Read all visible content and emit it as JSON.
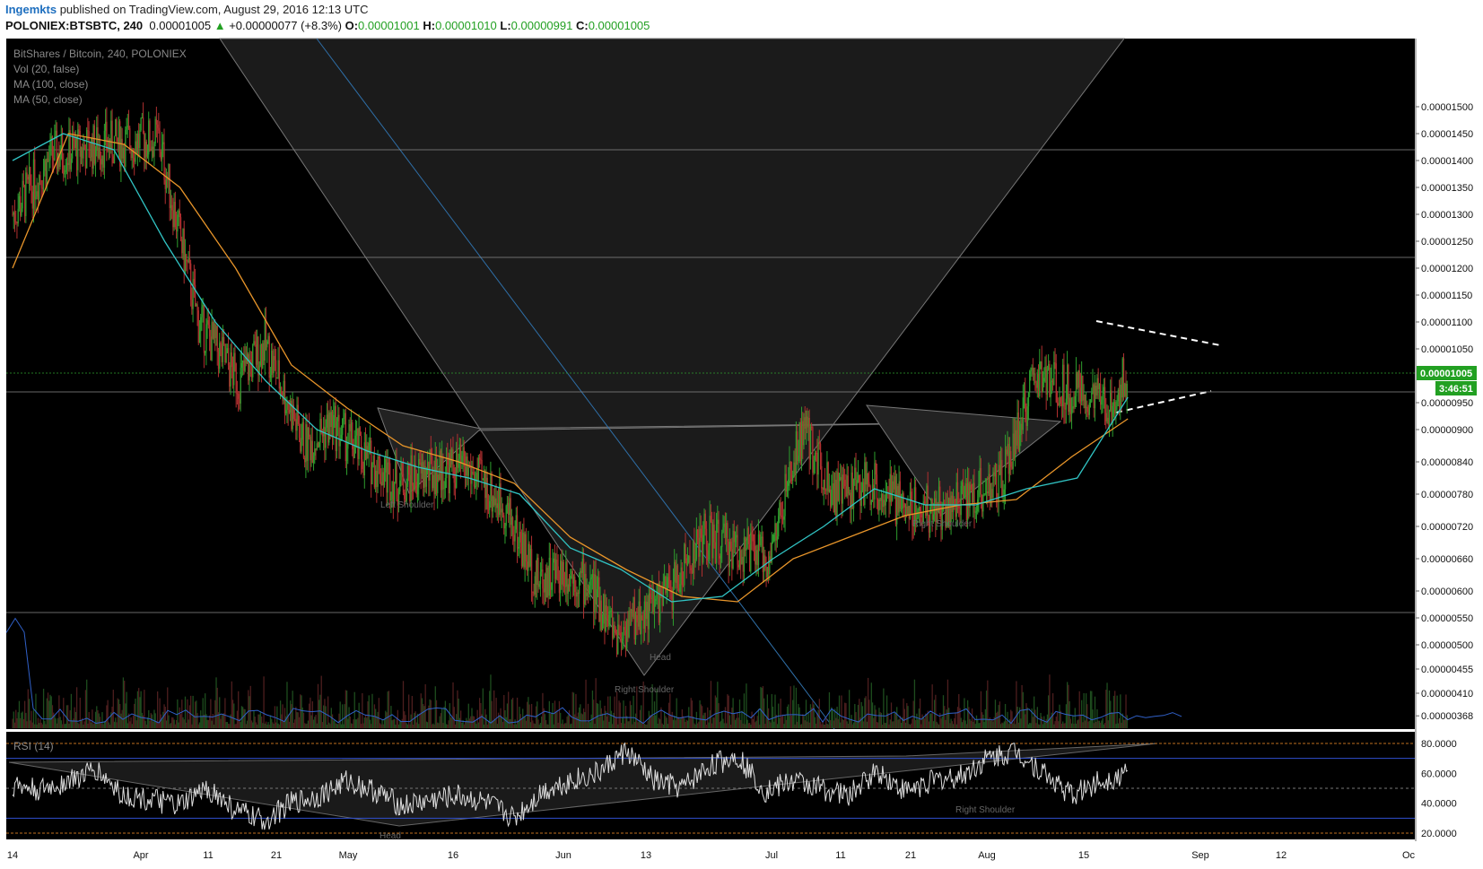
{
  "header": {
    "author": "Ingemkts",
    "published": "published on TradingView.com, August 29, 2016 12:13 UTC",
    "symbol": "POLONIEX:BTSBTC, 240",
    "price": "0.00001005",
    "change_arrow": "▲",
    "change": "+0.00000077 (+8.3%)",
    "open_label": "O:",
    "open": "0.00001001",
    "high_label": "H:",
    "high": "0.00001010",
    "low_label": "L:",
    "low": "0.00000991",
    "close_label": "C:",
    "close": "0.00001005"
  },
  "legend": {
    "title": "BitShares / Bitcoin, 240, POLONIEX",
    "vol": "Vol (20, false)",
    "ma100": "MA (100, close)",
    "ma50": "MA (50, close)",
    "rsi": "RSI (14)"
  },
  "pattern_labels": {
    "left_shoulder": "Left Shoulder",
    "head": "Head",
    "right_shoulder_1": "Right Shoulder",
    "right_shoulder_2": "Right Shoulder",
    "rsi_head": "Head",
    "rsi_right": "Right Shoulder"
  },
  "colors": {
    "background": "#000000",
    "up": "#2e9e2e",
    "down": "#b03030",
    "ma50": "#31c4c4",
    "ma100": "#e8952a",
    "volume_ma": "#3060c8",
    "rsi_line": "#dddddd",
    "price_label": "#22a022"
  },
  "chart_data": [
    {
      "type": "candlestick",
      "title": "BitShares / Bitcoin, 240, POLONIEX",
      "y_ticks": [
        "0.00001500",
        "0.00001450",
        "0.00001400",
        "0.00001350",
        "0.00001300",
        "0.00001250",
        "0.00001200",
        "0.00001150",
        "0.00001100",
        "0.00001050",
        "0.00000950",
        "0.00000900",
        "0.00000840",
        "0.00000780",
        "0.00000720",
        "0.00000660",
        "0.00000600",
        "0.00000550",
        "0.00000500",
        "0.00000455",
        "0.00000410",
        "0.00000368"
      ],
      "x_ticks": [
        "14",
        "Apr",
        "11",
        "21",
        "May",
        "16",
        "Jun",
        "13",
        "Jul",
        "11",
        "21",
        "Aug",
        "15",
        "Sep",
        "12",
        "Oc"
      ],
      "last_price": "0.00001005",
      "countdown": "3:46:51",
      "horizontal_levels": [
        1.42e-05,
        1.22e-05,
        9.7e-06,
        5.6e-06
      ],
      "path": {
        "x": [
          "Mar 14",
          "Mar 20",
          "Mar 28",
          "Apr 5",
          "Apr 11",
          "Apr 17",
          "Apr 21",
          "Apr 27",
          "May 1",
          "May 6",
          "May 11",
          "May 16",
          "May 21",
          "May 27",
          "Jun 1",
          "Jun 5",
          "Jun 9",
          "Jun 13",
          "Jun 17",
          "Jun 21",
          "Jun 26",
          "Jul 1",
          "Jul 6",
          "Jul 11",
          "Jul 16",
          "Jul 21",
          "Jul 26",
          "Aug 1",
          "Aug 6",
          "Aug 10",
          "Aug 15",
          "Aug 19",
          "Aug 23",
          "Aug 26",
          "Aug 29"
        ],
        "close": [
          1.3e-05,
          1.41e-05,
          1.43e-05,
          1.44e-05,
          1.1e-05,
          9.9e-06,
          1.06e-05,
          8.7e-06,
          9.1e-06,
          8.5e-06,
          8e-06,
          8.2e-06,
          8.3e-06,
          7.6e-06,
          6.2e-06,
          6.4e-06,
          6.1e-06,
          5.2e-06,
          5.6e-06,
          6e-06,
          7e-06,
          6.8e-06,
          6.6e-06,
          9e-06,
          7.8e-06,
          8e-06,
          7.6e-06,
          7.5e-06,
          7.8e-06,
          8e-06,
          1e-05,
          9.8e-06,
          9.6e-06,
          9.4e-06,
          1.005e-05
        ]
      },
      "ma50": [
        1.4e-05,
        1.45e-05,
        1.42e-05,
        1.25e-05,
        1.1e-05,
        9.9e-06,
        9e-06,
        8.6e-06,
        8.3e-06,
        8.1e-06,
        7.8e-06,
        6.8e-06,
        6.4e-06,
        5.8e-06,
        5.9e-06,
        6.6e-06,
        7.2e-06,
        7.9e-06,
        7.6e-06,
        7.6e-06,
        7.9e-06,
        8.1e-06,
        9.6e-06
      ],
      "ma100": [
        1.2e-05,
        1.45e-05,
        1.43e-05,
        1.35e-05,
        1.2e-05,
        1.02e-05,
        9.4e-06,
        8.7e-06,
        8.4e-06,
        8e-06,
        7e-06,
        6.4e-06,
        5.9e-06,
        5.8e-06,
        6.6e-06,
        7e-06,
        7.4e-06,
        7.6e-06,
        7.7e-06,
        8.5e-06,
        9.2e-06
      ]
    },
    {
      "type": "line",
      "title": "RSI (14)",
      "y_ticks": [
        "80.0000",
        "60.0000",
        "40.0000",
        "20.0000"
      ],
      "ylim": [
        20,
        80
      ],
      "levels": {
        "upper": 70,
        "middle": 50,
        "lower": 30
      },
      "values": [
        52,
        48,
        55,
        62,
        45,
        42,
        38,
        50,
        35,
        28,
        40,
        45,
        55,
        48,
        38,
        42,
        45,
        40,
        30,
        48,
        55,
        60,
        75,
        55,
        50,
        65,
        72,
        48,
        55,
        50,
        45,
        62,
        48,
        55,
        58,
        70,
        75,
        60,
        45,
        55,
        60
      ]
    }
  ]
}
